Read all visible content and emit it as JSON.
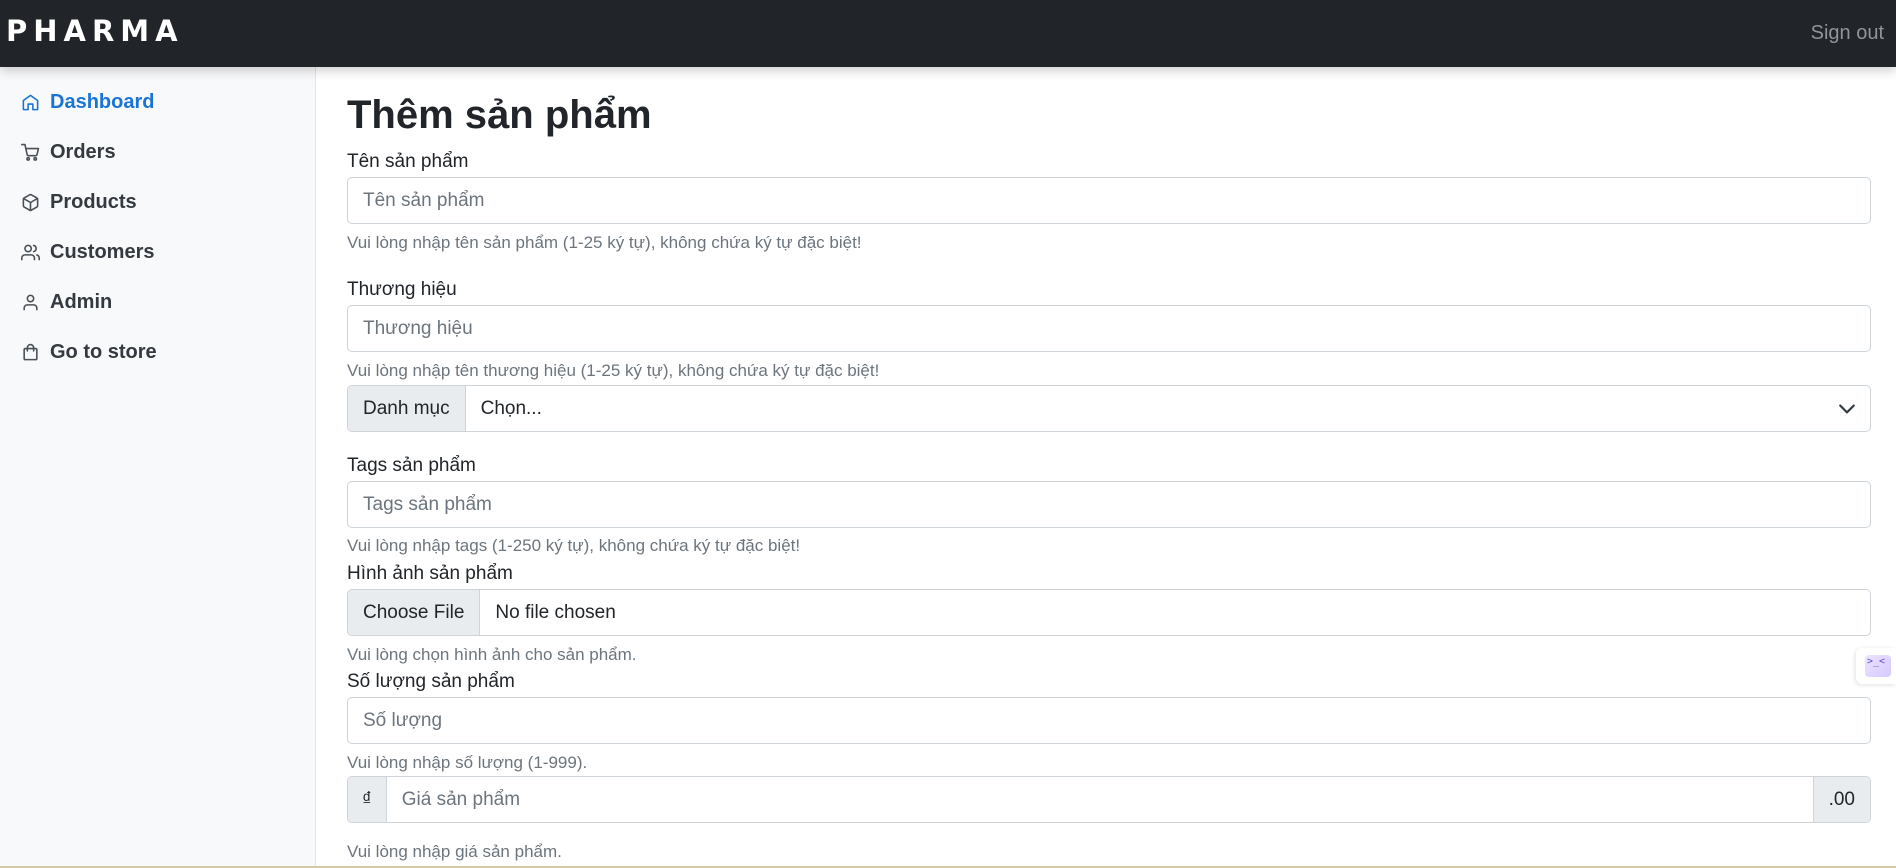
{
  "app": {
    "brand": "PHARMA",
    "signout_label": "Sign out"
  },
  "sidebar": {
    "items": [
      {
        "label": "Dashboard",
        "icon": "home-icon",
        "active": true
      },
      {
        "label": "Orders",
        "icon": "cart-icon"
      },
      {
        "label": "Products",
        "icon": "box-icon"
      },
      {
        "label": "Customers",
        "icon": "users-icon"
      },
      {
        "label": "Admin",
        "icon": "user-icon"
      },
      {
        "label": "Go to store",
        "icon": "shopping-bag-icon"
      }
    ]
  },
  "form": {
    "title": "Thêm sản phẩm",
    "name": {
      "label": "Tên sản phẩm",
      "placeholder": "Tên sản phẩm",
      "help": "Vui lòng nhập tên sản phẩm (1-25 ký tự), không chứa ký tự đặc biệt!"
    },
    "brand": {
      "label": "Thương hiệu",
      "placeholder": "Thương hiệu",
      "help": "Vui lòng nhập tên thương hiệu (1-25 ký tự), không chứa ký tự đặc biệt!"
    },
    "category": {
      "addon": "Danh mục",
      "selected": "Chọn..."
    },
    "tags": {
      "label": "Tags sản phẩm",
      "placeholder": "Tags sản phẩm",
      "help": "Vui lòng nhập tags (1-250 ký tự), không chứa ký tự đặc biệt!"
    },
    "image": {
      "label": "Hình ảnh sản phẩm",
      "button": "Choose File",
      "status": "No file chosen",
      "help": "Vui lòng chọn hình ảnh cho sản phẩm."
    },
    "quantity": {
      "label": "Số lượng sản phẩm",
      "placeholder": "Số lượng",
      "help": "Vui lòng nhập số lượng (1-999)."
    },
    "price": {
      "prefix": "₫",
      "placeholder": "Giá sản phẩm",
      "suffix": ".00",
      "help": "Vui lòng nhập giá sản phẩm."
    }
  },
  "colors": {
    "topbar": "#212529",
    "sidebar_bg": "#f8f9fa",
    "accent": "#1a73d6"
  }
}
